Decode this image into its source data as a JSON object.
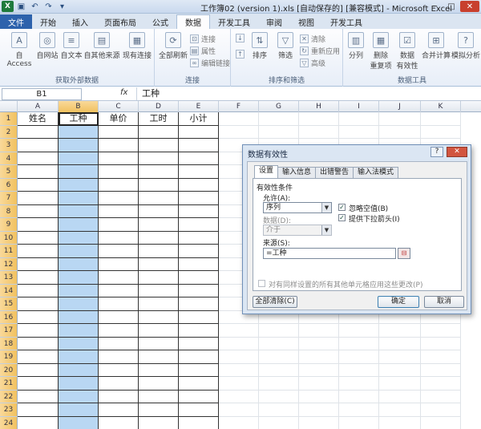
{
  "window": {
    "title": "工作簿02 (version 1).xls [自动保存的] [兼容模式] - Microsoft Excel",
    "controls": [
      "─",
      "□",
      "✕"
    ]
  },
  "tabs": [
    {
      "label": "文件",
      "kind": "file"
    },
    {
      "label": "开始",
      "kind": "normal"
    },
    {
      "label": "插入",
      "kind": "normal"
    },
    {
      "label": "页面布局",
      "kind": "normal"
    },
    {
      "label": "公式",
      "kind": "normal"
    },
    {
      "label": "数据",
      "kind": "active"
    },
    {
      "label": "开发工具",
      "kind": "normal"
    },
    {
      "label": "审阅",
      "kind": "normal"
    },
    {
      "label": "视图",
      "kind": "normal"
    },
    {
      "label": "开发工具",
      "kind": "normal"
    }
  ],
  "ribbon": {
    "groups": {
      "external": "获取外部数据",
      "connections": "连接",
      "sort_filter": "排序和筛选",
      "data_tools": "数据工具"
    },
    "buttons": {
      "from_access": "自 Access",
      "from_web": "自网站",
      "from_text": "自文本",
      "from_other": "自其他来源",
      "existing_conn": "现有连接",
      "refresh_all": "全部刷新",
      "connections": "连接",
      "properties": "属性",
      "edit_links": "编辑链接",
      "sort": "排序",
      "filter": "筛选",
      "clear": "清除",
      "reapply": "重新应用",
      "advanced": "高级",
      "text_to_columns": "分列",
      "remove_dup": "删除\n重复项",
      "validation": "数据\n有效性",
      "consolidate": "合并计算",
      "whatif": "模拟分析"
    }
  },
  "formula_bar": {
    "name_box": "B1",
    "fx": "fx",
    "value": "工种"
  },
  "grid": {
    "columns": [
      "A",
      "B",
      "C",
      "D",
      "E",
      "F",
      "G",
      "H",
      "I",
      "J",
      "K"
    ],
    "rows": [
      "1",
      "2",
      "3",
      "4",
      "5",
      "6",
      "7",
      "8",
      "9",
      "10",
      "11",
      "12",
      "13",
      "14",
      "15",
      "16",
      "17",
      "18",
      "19",
      "20",
      "21",
      "22",
      "23",
      "24"
    ],
    "headers": [
      "姓名",
      "工种",
      "单价",
      "工时",
      "小计"
    ]
  },
  "dialog": {
    "title": "数据有效性",
    "help": "?",
    "close": "✕",
    "tabs": [
      "设置",
      "输入信息",
      "出错警告",
      "输入法模式"
    ],
    "section_label": "有效性条件",
    "allow_label": "允许(A):",
    "allow_value": "序列",
    "data_label": "数据(D):",
    "data_value": "介于",
    "ignore_blank": "忽略空值(B)",
    "dropdown": "提供下拉箭头(I)",
    "source_label": "来源(S):",
    "source_value": "=工种",
    "apply_all": "对有同样设置的所有其他单元格应用这些更改(P)",
    "clear_all": "全部清除(C)",
    "ok": "确定",
    "cancel": "取消"
  }
}
